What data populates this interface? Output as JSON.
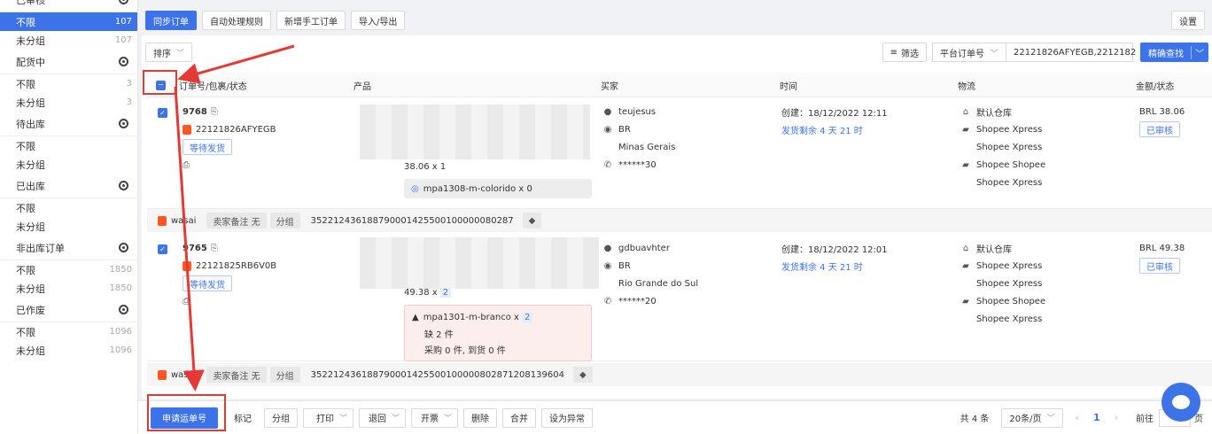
{
  "sidebar": {
    "groups": [
      {
        "title": "已审核",
        "items": [
          {
            "label": "不限",
            "count": "107"
          },
          {
            "label": "未分组",
            "count": "107"
          }
        ]
      },
      {
        "title": "配货中",
        "items": [
          {
            "label": "不限",
            "count": "3"
          },
          {
            "label": "未分组",
            "count": "3"
          }
        ]
      },
      {
        "title": "待出库",
        "items": [
          {
            "label": "不限",
            "count": ""
          },
          {
            "label": "未分组",
            "count": ""
          }
        ]
      },
      {
        "title": "已出库",
        "items": [
          {
            "label": "不限",
            "count": ""
          },
          {
            "label": "未分组",
            "count": ""
          }
        ]
      },
      {
        "title": "非出库订单",
        "items": [
          {
            "label": "不限",
            "count": "1850"
          },
          {
            "label": "未分组",
            "count": "1850"
          }
        ]
      },
      {
        "title": "已作废",
        "items": [
          {
            "label": "不限",
            "count": "1096"
          },
          {
            "label": "未分组",
            "count": "1096"
          }
        ]
      }
    ]
  },
  "toolbar": {
    "sync": "同步订单",
    "auto_rules": "自动处理规则",
    "new_manual": "新增手工订单",
    "import_export": "导入/导出",
    "settings": "设置"
  },
  "filters": {
    "sort": "排序",
    "filter": "筛选",
    "field": "平台订单号",
    "search_value": "22121826AFYEGB,2212182",
    "exact_search": "精确查找"
  },
  "table": {
    "col_order": "订单号/包裹/状态",
    "col_product": "产品",
    "col_buyer": "买家",
    "col_time": "时间",
    "col_logistics": "物流",
    "col_amount": "金额/状态"
  },
  "orders": [
    {
      "id": "9768",
      "platform_no": "22121826AFYEGB",
      "status": "等待发货",
      "price_qty": "38.06 x 1",
      "sku": "mpa1308-m-colorido x 0",
      "buyer": "teujesus",
      "country": "BR",
      "region": "Minas Gerais",
      "phone": "******30",
      "created": "创建：18/12/2022 12:11",
      "remaining": "发货剩余 4 天 21 时",
      "warehouse": "默认仓库",
      "log1": "Shopee Xpress",
      "log2": "Shopee Xpress",
      "log3": "Shopee Shopee",
      "log4": "Shopee Xpress",
      "amount": "BRL 38.06",
      "review": "已审核",
      "shop": "wasai",
      "seller_note": "卖家备注 无",
      "group": "分组",
      "package_no": "352212436188790001425500100000080287"
    },
    {
      "id": "9765",
      "platform_no": "22121825RB6V0B",
      "status": "等待发货",
      "price_qty": "49.38 x",
      "qty": "2",
      "sku": "mpa1301-m-branco x",
      "sku_qty": "2",
      "short": "缺 2 件",
      "purchase": "采购 0 件, 到货 0 件",
      "buyer": "gdbuavhter",
      "country": "BR",
      "region": "Rio Grande do Sul",
      "phone": "******20",
      "created": "创建：18/12/2022 12:01",
      "remaining": "发货剩余 4 天 21 时",
      "warehouse": "默认仓库",
      "log1": "Shopee Xpress",
      "log2": "Shopee Xpress",
      "log3": "Shopee Shopee",
      "log4": "Shopee Xpress",
      "amount": "BRL 49.38",
      "review": "已审核",
      "shop": "wasai",
      "seller_note": "卖家备注 无",
      "group": "分组",
      "package_no": "352212436188790001425500100000802871208139604"
    }
  ],
  "bottom": {
    "apply_waybill": "申请运单号",
    "mark": "标记",
    "group": "分组",
    "print": "打印",
    "return": "退回",
    "invoice": "开票",
    "delete": "删除",
    "merge": "合并",
    "set_abnormal": "设为异常",
    "total": "共 4 条",
    "page_size": "20条/页",
    "current_page": "1",
    "goto": "前往",
    "page_suffix": "页"
  },
  "colors": {
    "primary": "#3d73e8",
    "annotation": "#e53935"
  }
}
